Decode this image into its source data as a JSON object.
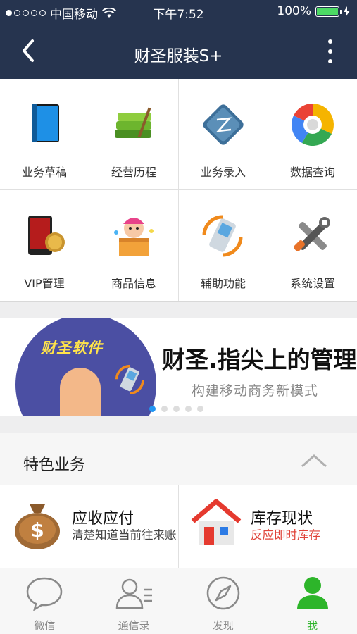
{
  "status_bar": {
    "carrier": "中国移动",
    "time": "下午7:52",
    "battery": "100%"
  },
  "nav": {
    "title": "财圣服装S+"
  },
  "grid": {
    "items": [
      {
        "label": "业务草稿",
        "icon": "book-icon"
      },
      {
        "label": "经营历程",
        "icon": "books-stack-icon"
      },
      {
        "label": "业务录入",
        "icon": "entry-icon"
      },
      {
        "label": "数据查询",
        "icon": "pie-query-icon"
      },
      {
        "label": "VIP管理",
        "icon": "vip-card-icon"
      },
      {
        "label": "商品信息",
        "icon": "gift-box-icon"
      },
      {
        "label": "辅助功能",
        "icon": "phone-sync-icon"
      },
      {
        "label": "系统设置",
        "icon": "tools-icon"
      }
    ]
  },
  "banner": {
    "logo": "财圣软件",
    "title": "财圣.指尖上的管理",
    "subtitle": "构建移动商务新模式",
    "page_count": 5,
    "active_page": 1
  },
  "featured": {
    "title": "特色业务",
    "cards": [
      {
        "title": "应收应付",
        "desc": "清楚知道当前往来账",
        "icon": "money-bag-icon"
      },
      {
        "title": "库存现状",
        "desc": "反应即时库存",
        "icon": "house-icon"
      }
    ]
  },
  "tabs": [
    {
      "label": "微信",
      "icon": "chat-bubble-icon",
      "active": false
    },
    {
      "label": "通信录",
      "icon": "contacts-icon",
      "active": false
    },
    {
      "label": "发现",
      "icon": "compass-icon",
      "active": false
    },
    {
      "label": "我",
      "icon": "person-icon",
      "active": true
    }
  ],
  "colors": {
    "nav_bg": "#26344f",
    "active_tab": "#2db52a",
    "accent_red": "#e0443a",
    "banner_dot_active": "#2196f3"
  }
}
